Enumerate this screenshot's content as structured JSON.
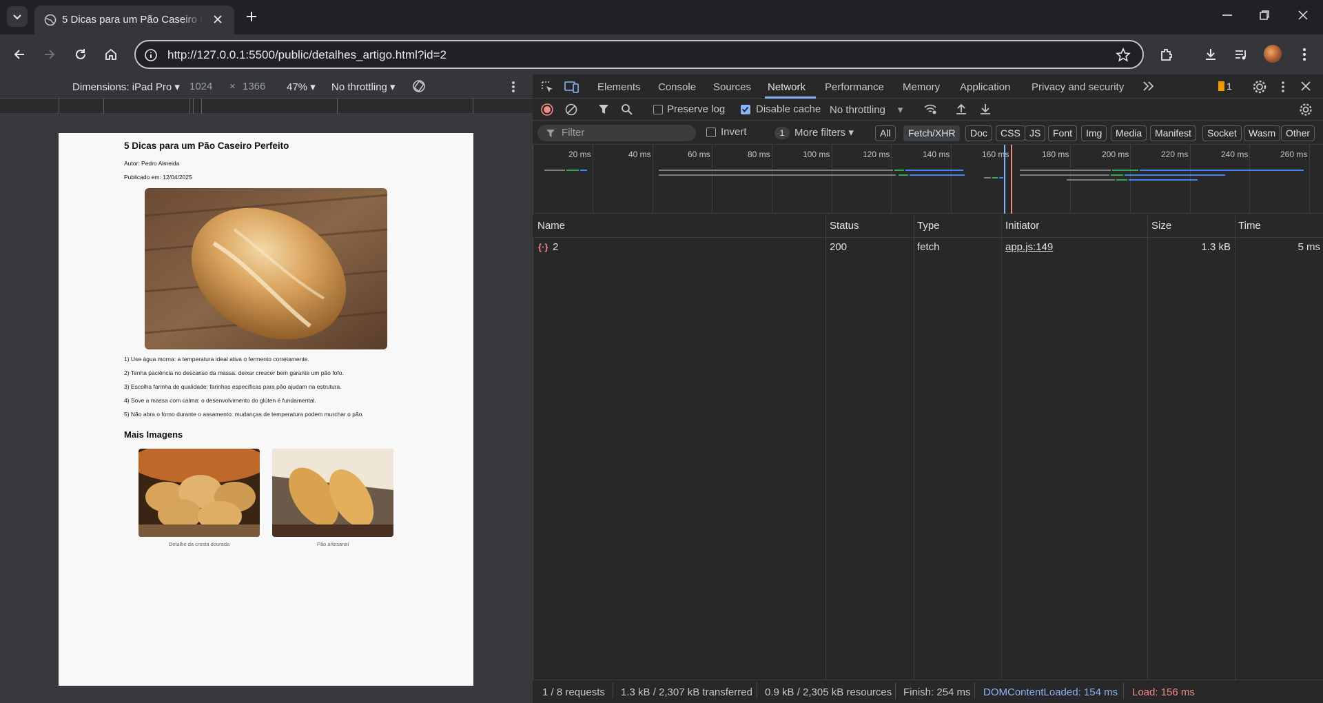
{
  "browser": {
    "tab_title": "5 Dicas para um Pão Caseiro Perfeito",
    "url": "http://127.0.0.1:5500/public/detalhes_artigo.html?id=2"
  },
  "device_toolbar": {
    "dimensions_label": "Dimensions: iPad Pro",
    "width": "1024",
    "times": "×",
    "height": "1366",
    "zoom": "47%",
    "throttling": "No throttling"
  },
  "article": {
    "title": "5 Dicas para um Pão Caseiro Perfeito",
    "author": "Autor: Pedro Almeida",
    "published": "Publicado em: 12/04/2025",
    "tips": [
      "1) Use água morna: a temperatura ideal ativa o fermento corretamente.",
      "2) Tenha paciência no descanso da massa: deixar crescer bem garante um pão fofo.",
      "3) Escolha farinha de qualidade: farinhas específicas para pão ajudam na estrutura.",
      "4) Sove a massa com calma: o desenvolvimento do glúten é fundamental.",
      "5) Não abra o forno durante o assamento: mudanças de temperatura podem murchar o pão."
    ],
    "more_images_title": "Mais Imagens",
    "captions": [
      "Detalhe da crosta dourada",
      "Pão artesanal"
    ]
  },
  "devtools": {
    "tabs": [
      "Elements",
      "Console",
      "Sources",
      "Network",
      "Performance",
      "Memory",
      "Application",
      "Privacy and security"
    ],
    "active_tab": "Network",
    "issues_count": "1",
    "preserve_log": "Preserve log",
    "disable_cache": "Disable cache",
    "throttling": "No throttling",
    "filter_placeholder": "Filter",
    "invert": "Invert",
    "more_filters_count": "1",
    "more_filters": "More filters",
    "type_filters": [
      "All",
      "Fetch/XHR",
      "Doc",
      "CSS",
      "JS",
      "Font",
      "Img",
      "Media",
      "Manifest",
      "Socket",
      "Wasm",
      "Other"
    ],
    "active_filter": "Fetch/XHR",
    "timeline_ticks": [
      "20 ms",
      "40 ms",
      "60 ms",
      "80 ms",
      "100 ms",
      "120 ms",
      "140 ms",
      "160 ms",
      "180 ms",
      "200 ms",
      "220 ms",
      "240 ms",
      "260 ms"
    ],
    "columns": [
      "Name",
      "Status",
      "Type",
      "Initiator",
      "Size",
      "Time"
    ],
    "rows": [
      {
        "name": "2",
        "status": "200",
        "type": "fetch",
        "initiator": "app.js:149",
        "size": "1.3 kB",
        "time": "5 ms"
      }
    ],
    "status": {
      "requests": "1 / 8 requests",
      "transferred": "1.3 kB / 2,307 kB transferred",
      "resources": "0.9 kB / 2,305 kB resources",
      "finish": "Finish: 254 ms",
      "dcl": "DOMContentLoaded: 154 ms",
      "load": "Load: 156 ms"
    },
    "colors": {
      "dcl": "#8ab4f8",
      "load": "#f28b82",
      "accent": "#8ab4f8"
    }
  }
}
